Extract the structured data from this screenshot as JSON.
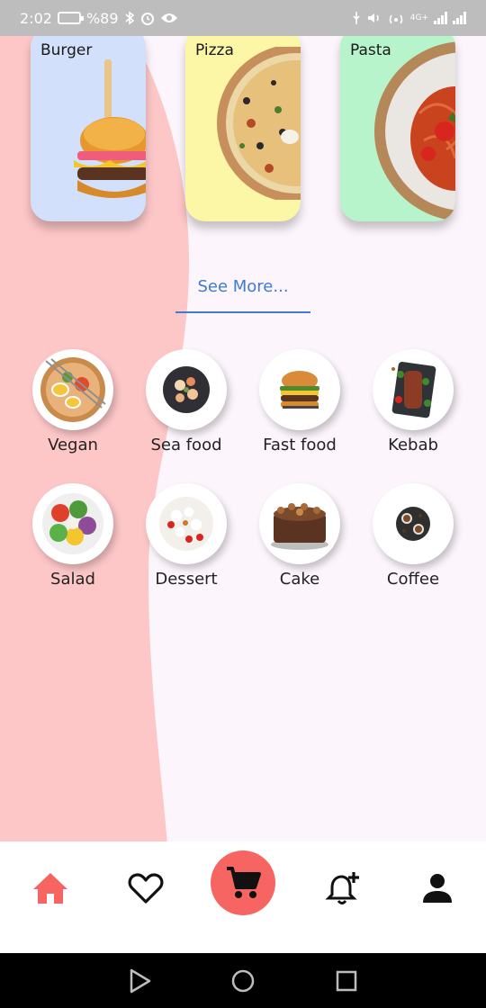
{
  "status_bar": {
    "time": "2:02",
    "battery": "%89",
    "network": "4G+"
  },
  "featured_cards": [
    {
      "label": "Burger",
      "bg": "#d3e0fb"
    },
    {
      "label": "Pizza",
      "bg": "#fcf6a7"
    },
    {
      "label": "Pasta",
      "bg": "#b8f4cb"
    }
  ],
  "see_more": {
    "label": "See More..."
  },
  "categories": [
    {
      "label": "Vegan"
    },
    {
      "label": "Sea food"
    },
    {
      "label": "Fast food"
    },
    {
      "label": "Kebab"
    },
    {
      "label": "Salad"
    },
    {
      "label": "Dessert"
    },
    {
      "label": "Cake"
    },
    {
      "label": "Coffee"
    }
  ],
  "bottom_nav": {
    "items": [
      "home-icon",
      "heart-icon",
      "cart-icon",
      "bell-plus-icon",
      "person-icon"
    ],
    "active": "home-icon"
  },
  "colors": {
    "accent": "#f66561",
    "link": "#3f7bd0",
    "background": "#fcf5fc",
    "curve": "#fdc7c8"
  }
}
